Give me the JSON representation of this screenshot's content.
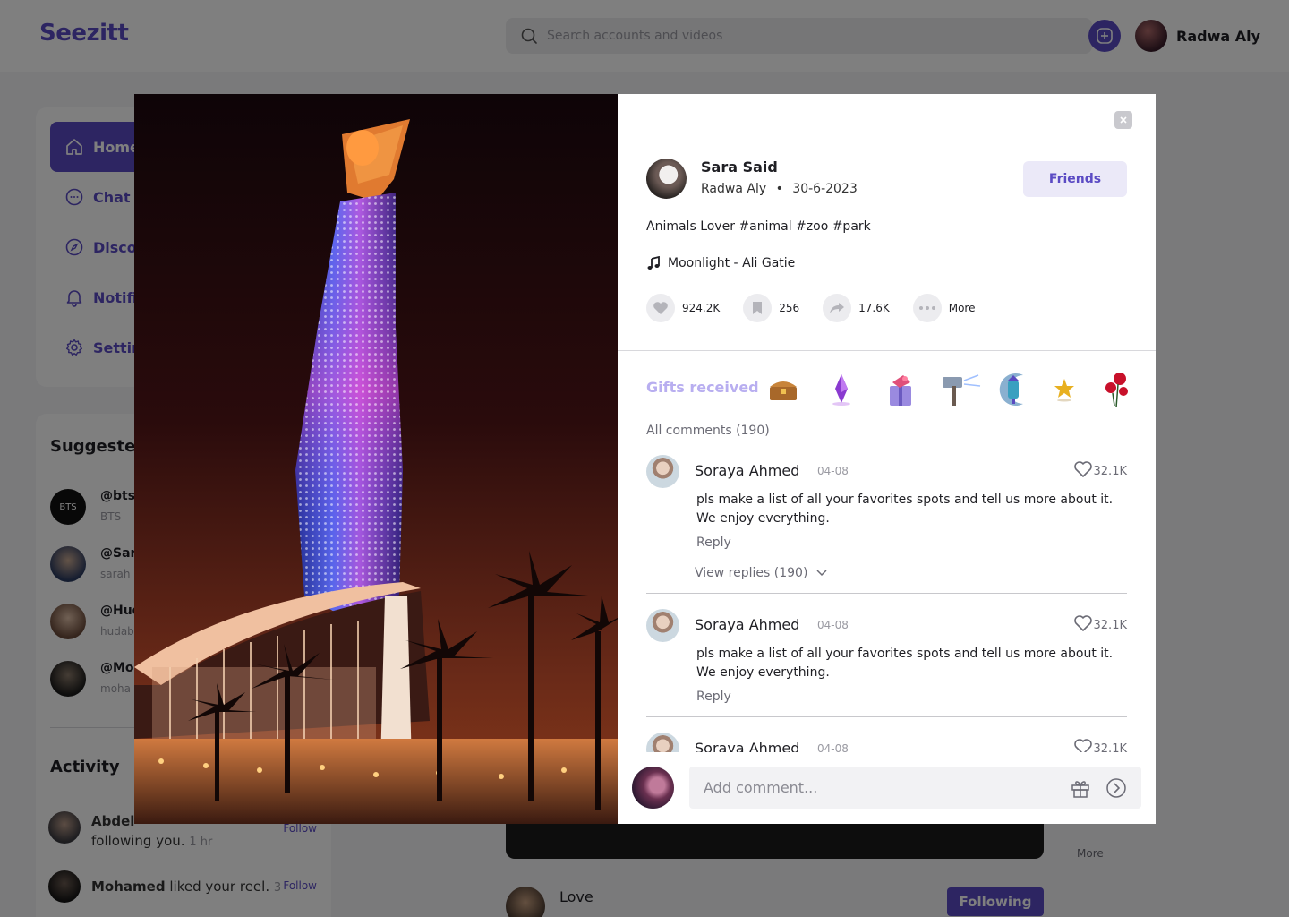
{
  "app": {
    "logo_text": "Seezitt",
    "accent_color": "#5b4bc4"
  },
  "header": {
    "search_placeholder": "Search accounts and videos",
    "create_icon": "plus-square-icon",
    "user_name": "Radwa Aly"
  },
  "sidebar": {
    "items": [
      {
        "label": "Home",
        "icon": "home-icon"
      },
      {
        "label": "Chat",
        "icon": "chat-icon"
      },
      {
        "label": "Discover",
        "icon": "compass-icon"
      },
      {
        "label": "Notifications",
        "icon": "bell-icon"
      },
      {
        "label": "Settings",
        "icon": "gear-icon"
      }
    ],
    "suggested_title": "Suggested",
    "suggested": [
      {
        "handle": "@bts",
        "sub": "BTS",
        "avatar_text": "BTS"
      },
      {
        "handle": "@Sar",
        "sub": "sarah"
      },
      {
        "handle": "@Hud",
        "sub": "hudab"
      },
      {
        "handle": "@Moh",
        "sub": "moha"
      }
    ],
    "activity_title": "Activity",
    "activity": [
      {
        "name": "Abdel",
        "text": "following you.",
        "time": "1 hr",
        "action": "Follow"
      },
      {
        "name": "Mohamed",
        "text": "liked your reel.",
        "time": "3",
        "action": "Follow"
      }
    ]
  },
  "feed": {
    "more_label": "More",
    "author": "Love",
    "following_label": "Following"
  },
  "post": {
    "author_name": "Sara Said",
    "author_sub_name": "Radwa Aly",
    "separator": "•",
    "date": "30-6-2023",
    "friends_label": "Friends",
    "caption": "Animals Lover #animal #zoo #park",
    "music": "Moonlight - Ali Gatie",
    "stats": {
      "likes": "924.2K",
      "saves": "256",
      "shares": "17.6K",
      "more_label": "More"
    },
    "gifts_label": "Gifts received",
    "gift_icons": [
      "treasure-chest-icon",
      "crystal-icon",
      "gift-box-icon",
      "hammer-icon",
      "lantern-icon",
      "star-icon",
      "rose-icon"
    ],
    "comments_label": "All comments (190)",
    "comments": [
      {
        "name": "Soraya Ahmed",
        "date": "04-08",
        "likes": "32.1K",
        "text": "pls make a list of all your favorites spots and tell us more about it. We enjoy everything.",
        "reply": "Reply",
        "view_replies": "View replies (190)"
      },
      {
        "name": "Soraya Ahmed",
        "date": "04-08",
        "likes": "32.1K",
        "text": "pls make a list of all your favorites spots and tell us more about it. We enjoy everything.",
        "reply": "Reply"
      },
      {
        "name": "Soraya Ahmed",
        "date": "04-08",
        "likes": "32.1K"
      }
    ],
    "composer_placeholder": "Add comment..."
  }
}
